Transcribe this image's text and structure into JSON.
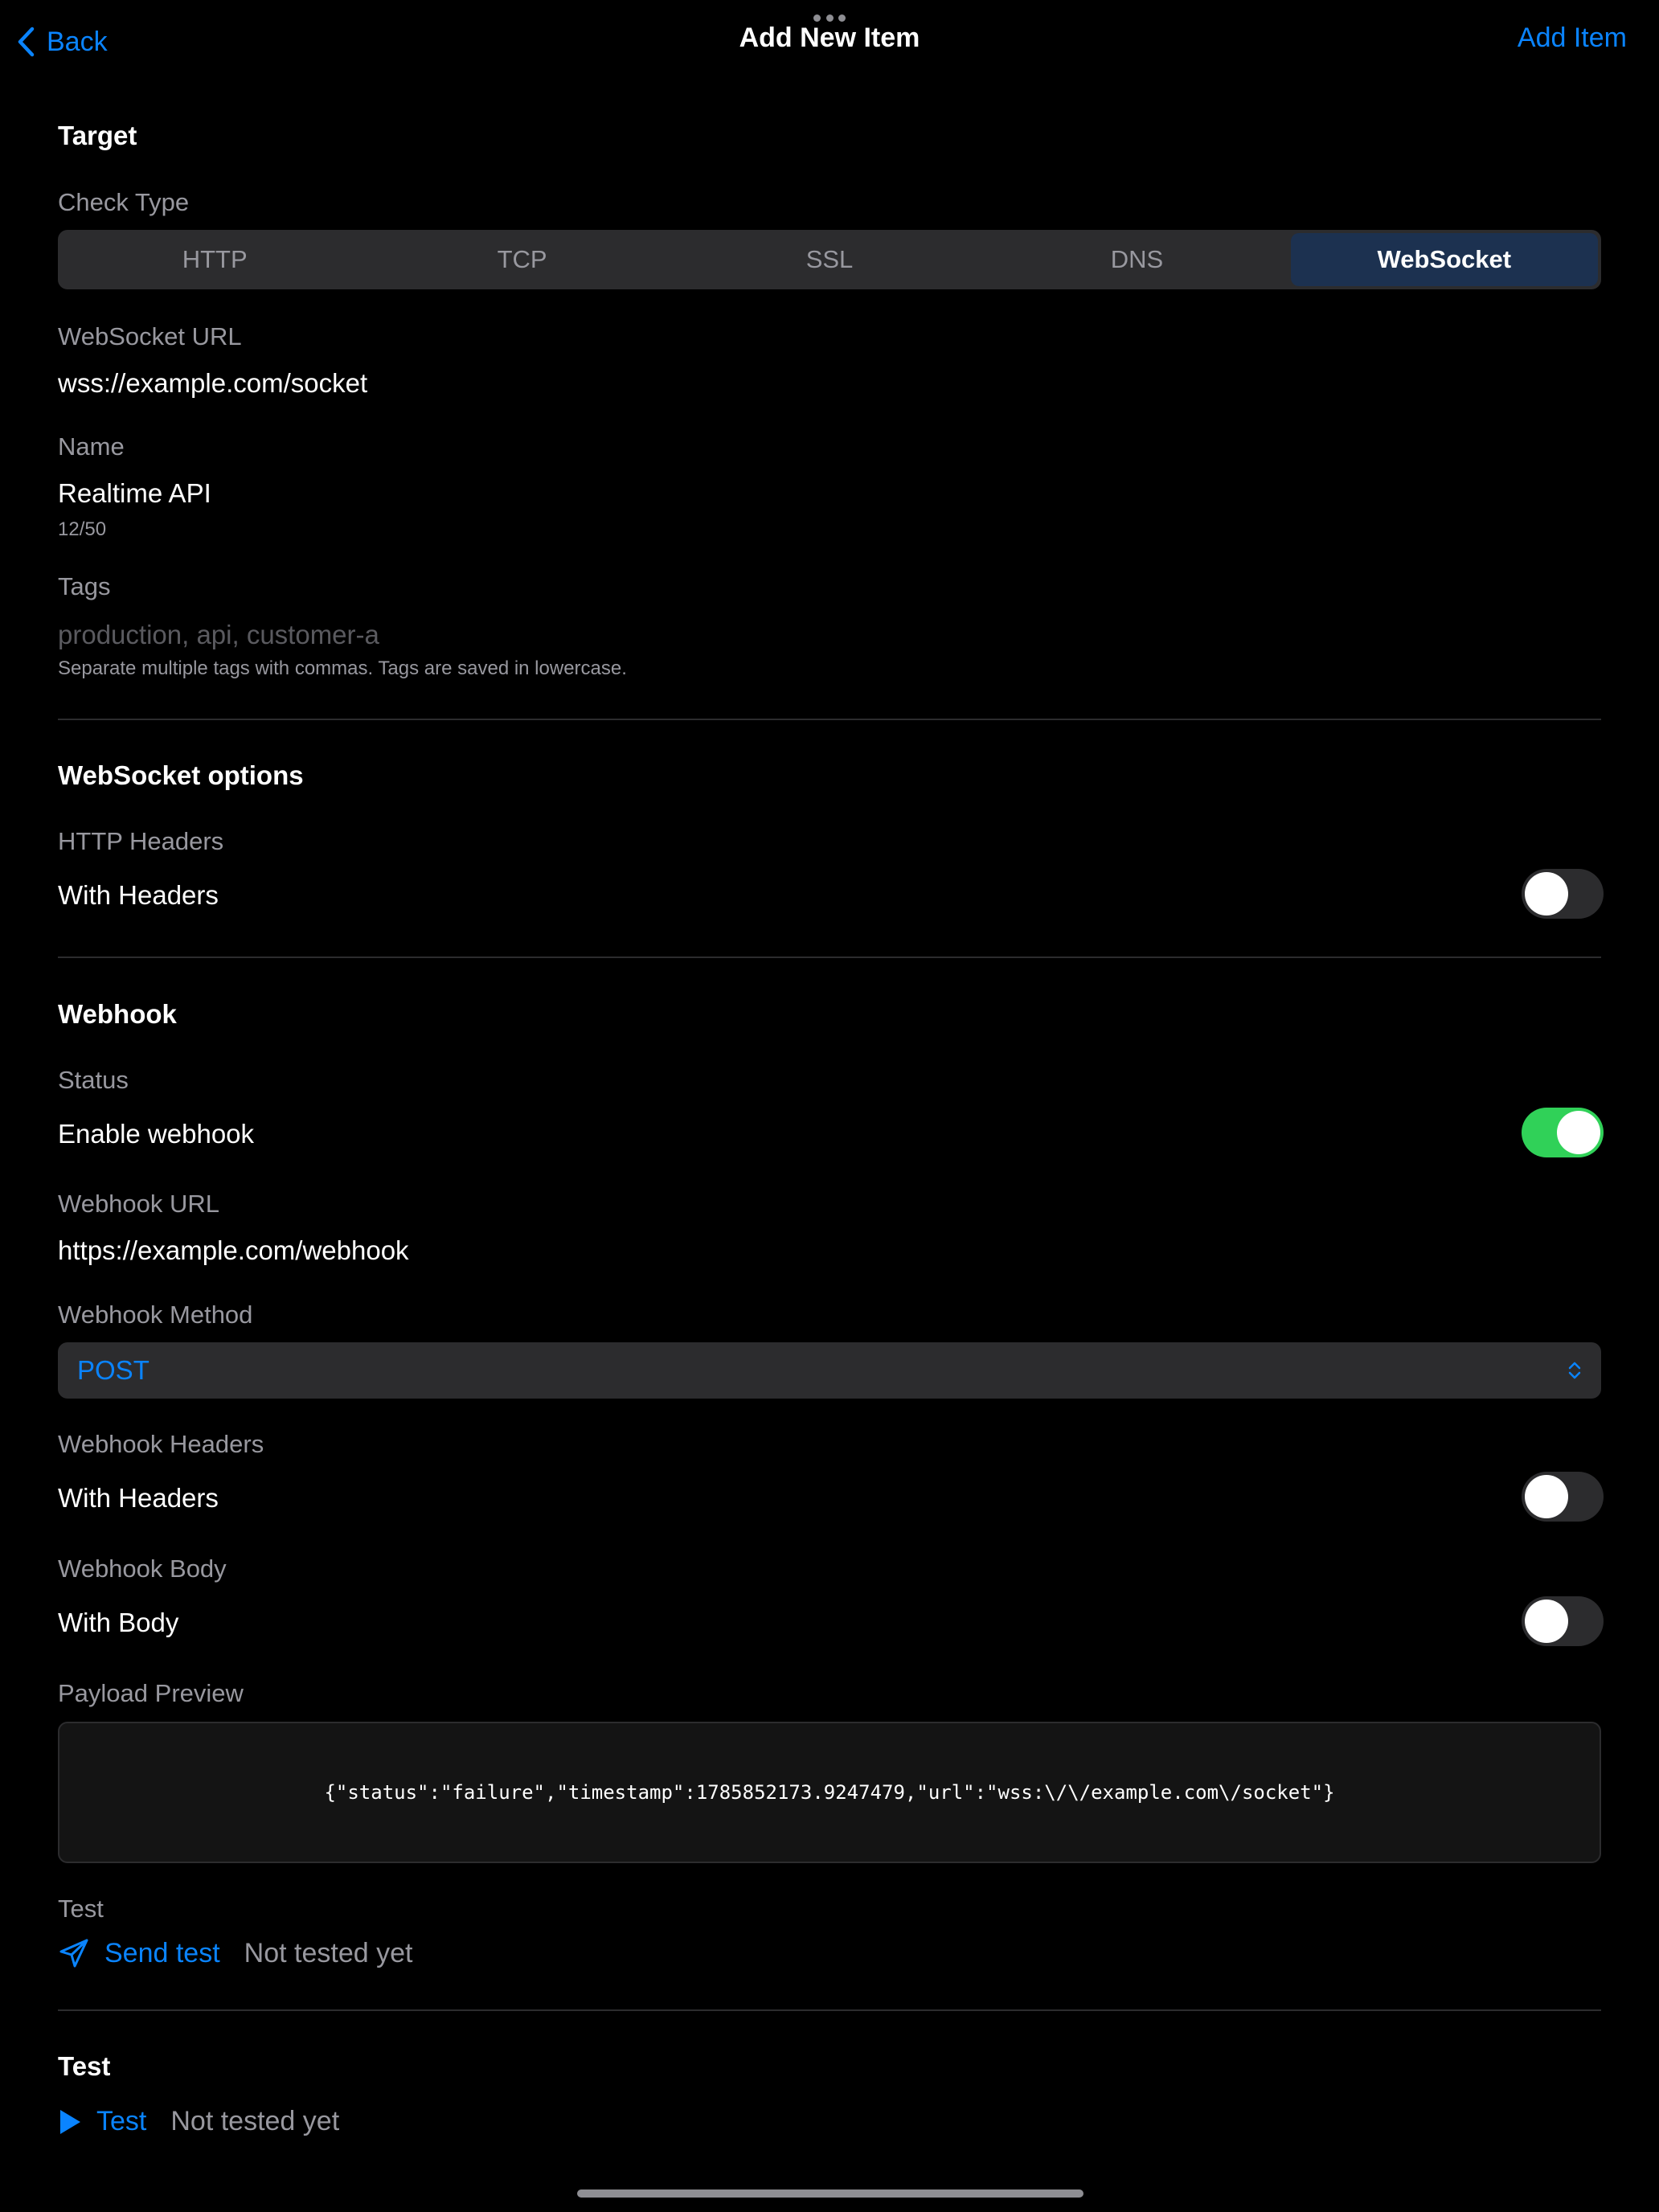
{
  "nav": {
    "back_label": "Back",
    "title": "Add New Item",
    "action_label": "Add Item"
  },
  "target": {
    "section_title": "Target",
    "check_type_label": "Check Type",
    "check_types": [
      "HTTP",
      "TCP",
      "SSL",
      "DNS",
      "WebSocket"
    ],
    "selected_check_type": "WebSocket",
    "url_label": "WebSocket URL",
    "url_value": "wss://example.com/socket",
    "name_label": "Name",
    "name_value": "Realtime API",
    "name_counter": "12/50",
    "tags_label": "Tags",
    "tags_placeholder": "production, api, customer-a",
    "tags_hint": "Separate multiple tags with commas. Tags are saved in lowercase."
  },
  "websocket_options": {
    "section_title": "WebSocket options",
    "headers_label": "HTTP Headers",
    "headers_toggle_label": "With Headers",
    "headers_enabled": false
  },
  "webhook": {
    "section_title": "Webhook",
    "status_label": "Status",
    "enable_label": "Enable webhook",
    "enabled": true,
    "url_label": "Webhook URL",
    "url_value": "https://example.com/webhook",
    "method_label": "Webhook Method",
    "method_value": "POST",
    "headers_label": "Webhook Headers",
    "headers_toggle_label": "With Headers",
    "headers_enabled": false,
    "body_label": "Webhook Body",
    "body_toggle_label": "With Body",
    "body_enabled": false,
    "payload_label": "Payload Preview",
    "payload_value": "{\"status\":\"failure\",\"timestamp\":1785852173.9247479,\"url\":\"wss:\\/\\/example.com\\/socket\"}",
    "test_label": "Test",
    "send_test_label": "Send test",
    "send_test_status": "Not tested yet"
  },
  "test_section": {
    "section_title": "Test",
    "test_button_label": "Test",
    "test_status": "Not tested yet"
  },
  "colors": {
    "accent": "#0a84ff",
    "toggle_on": "#30d158",
    "selected_segment": "#1c3150"
  }
}
